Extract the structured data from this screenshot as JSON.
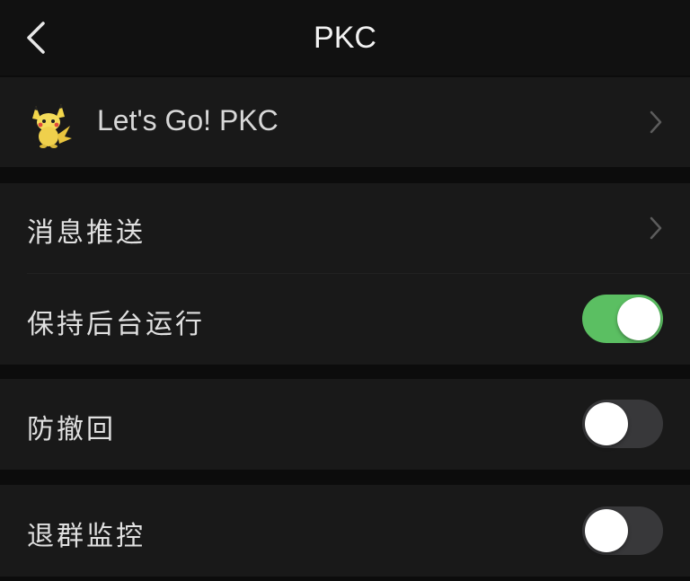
{
  "nav": {
    "title": "PKC",
    "back_icon": "chevron-left-icon"
  },
  "app_row": {
    "label": "Let's Go! PKC",
    "avatar_icon": "pikachu-avatar-icon",
    "chevron_icon": "chevron-right-icon"
  },
  "settings": {
    "push_label": "消息推送",
    "background_label": "保持后台运行",
    "background_on": true,
    "anti_recall_label": "防撤回",
    "anti_recall_on": false,
    "group_monitor_label": "退群监控",
    "group_monitor_on": false
  },
  "colors": {
    "background": "#0c0c0c",
    "cell": "#191919",
    "toggle_on": "#5bbf62",
    "toggle_off": "#38383a"
  }
}
